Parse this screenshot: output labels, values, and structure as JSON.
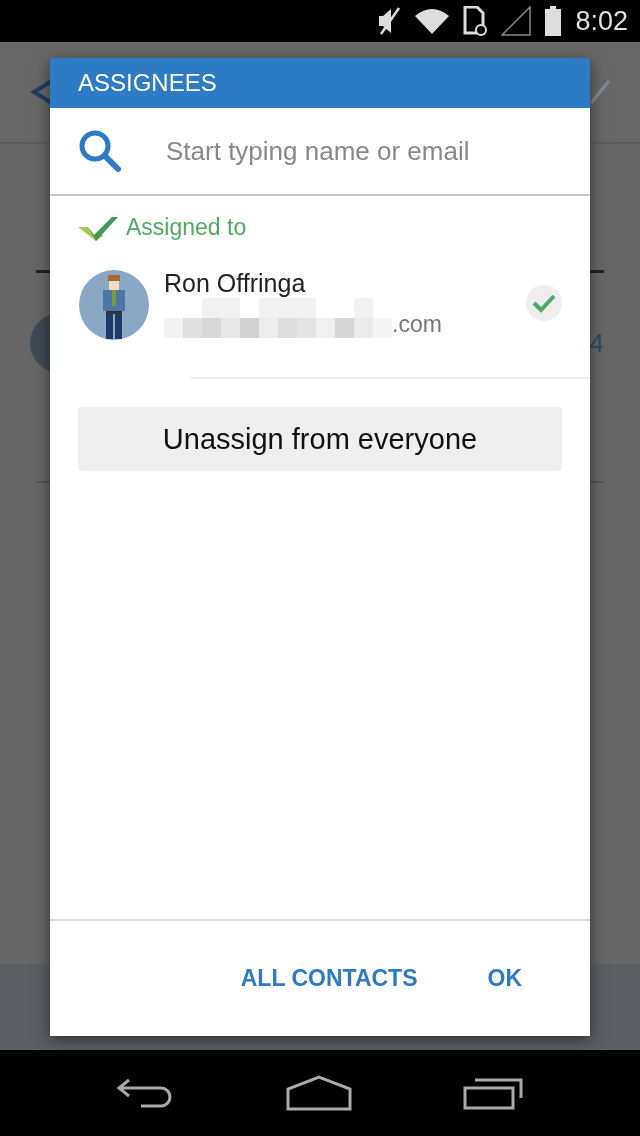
{
  "status_bar": {
    "time": "8:02"
  },
  "background": {
    "count_fragment": "4"
  },
  "dialog": {
    "title": "ASSIGNEES",
    "search": {
      "placeholder": "Start typing name or email"
    },
    "section": {
      "label": "Assigned to"
    },
    "assignees": [
      {
        "name": "Ron Offringa",
        "email_suffix": ".com",
        "selected": true
      }
    ],
    "unassign_button": "Unassign from everyone",
    "actions": [
      "ALL CONTACTS",
      "OK"
    ]
  }
}
